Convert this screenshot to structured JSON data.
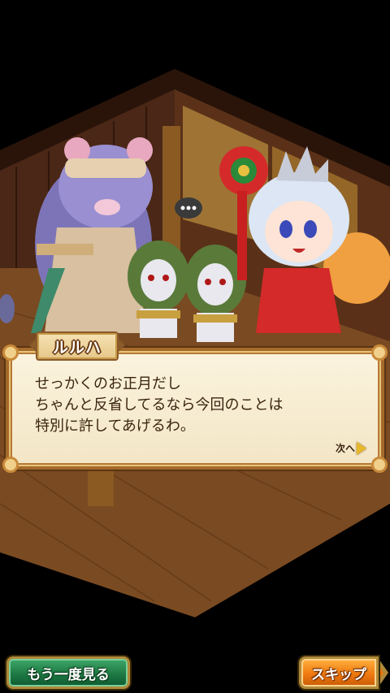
{
  "dialog": {
    "speaker": "ルルハ",
    "lines": [
      "せっかくのお正月だし",
      "ちゃんと反省してるなら今回のことは",
      "特別に許してあげるわ。"
    ],
    "next_label": "次へ"
  },
  "buttons": {
    "replay_label": "もう一度見る",
    "skip_label": "スキップ"
  },
  "colors": {
    "dialog_border": "#a56a2a",
    "replay_button": "#1e7a44",
    "skip_button": "#f07a10"
  },
  "icons": [
    "speech-bubble-ellipsis-icon",
    "next-arrow-icon",
    "skip-arrow-icon"
  ]
}
